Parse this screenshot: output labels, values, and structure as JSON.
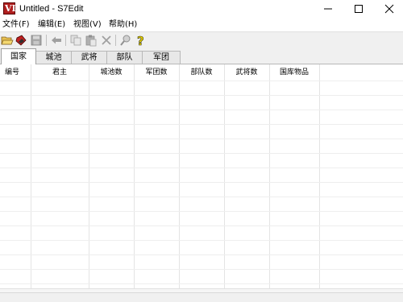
{
  "window": {
    "title": "Untitled - S7Edit",
    "icon_glyph": "VI"
  },
  "menu": {
    "items": [
      {
        "label": "文件(F)"
      },
      {
        "label": "编辑(E)"
      },
      {
        "label": "视图(V)"
      },
      {
        "label": "帮助(H)"
      }
    ]
  },
  "toolbar": {
    "buttons": [
      {
        "icon": "open-folder-icon"
      },
      {
        "icon": "tag-icon"
      },
      {
        "icon": "save-icon"
      },
      {
        "icon": "back-arrow-icon"
      },
      {
        "icon": "copy-icon"
      },
      {
        "icon": "paste-icon"
      },
      {
        "icon": "delete-icon"
      },
      {
        "icon": "search-icon"
      },
      {
        "icon": "help-icon"
      }
    ]
  },
  "tabs": [
    {
      "label": "国家",
      "active": true
    },
    {
      "label": "城池",
      "active": false
    },
    {
      "label": "武将",
      "active": false
    },
    {
      "label": "部队",
      "active": false
    },
    {
      "label": "军团",
      "active": false
    }
  ],
  "table": {
    "columns": [
      "编号",
      "君主",
      "城池数",
      "军团数",
      "部队数",
      "武将数",
      "国库物品"
    ],
    "rows": []
  },
  "colors": {
    "grid_line": "#e4e4e4",
    "toolbar_bg": "#f0f0f0",
    "icon_accent": "#b02020"
  }
}
